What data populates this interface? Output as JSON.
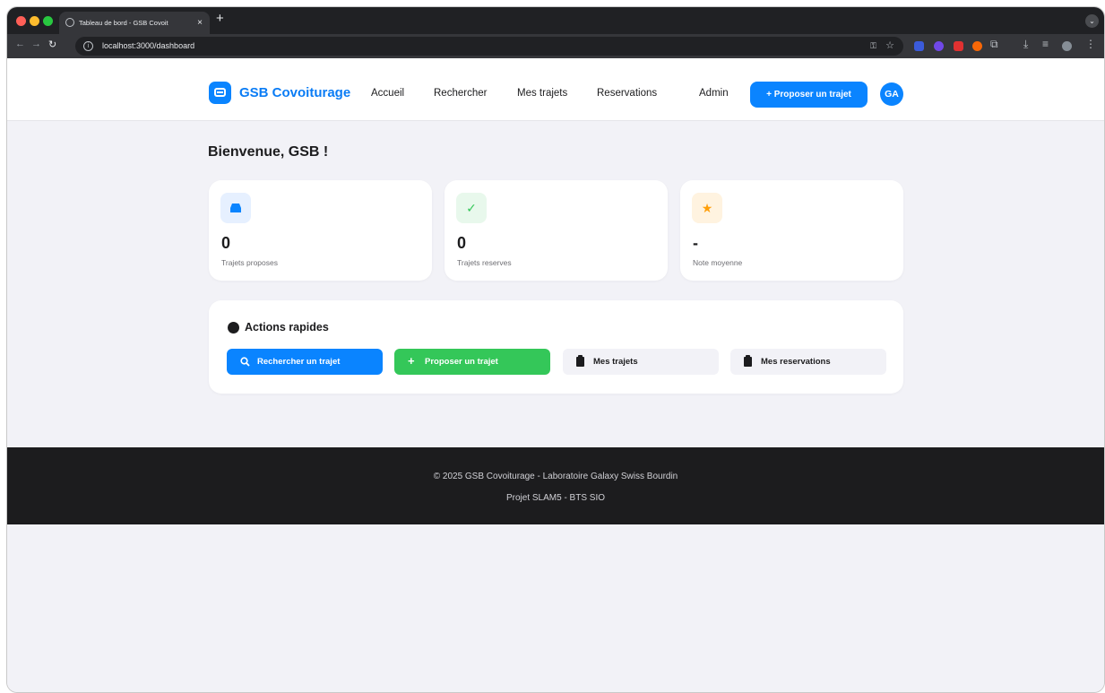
{
  "browser": {
    "tab_title": "Tableau de bord - GSB Covoit",
    "tab_close": "×",
    "new_tab": "+",
    "url": "localhost:3000/dashboard"
  },
  "header": {
    "brand": "GSB Covoiturage",
    "nav": [
      "Accueil",
      "Rechercher",
      "Mes trajets",
      "Reservations",
      "Admin"
    ],
    "cta": "+  Proposer un trajet",
    "avatar": "GA"
  },
  "welcome": "Bienvenue, GSB !",
  "stats": [
    {
      "value": "0",
      "label": "Trajets proposes",
      "icon": "car-icon",
      "icon_bg": "#e6f0ff",
      "icon_color": "#0a84ff"
    },
    {
      "value": "0",
      "label": "Trajets reserves",
      "icon": "check-icon",
      "icon_bg": "#e8f8ec",
      "icon_color": "#34c759"
    },
    {
      "value": "-",
      "label": "Note moyenne",
      "icon": "star-icon",
      "icon_bg": "#fff3e0",
      "icon_color": "#ff9f0a"
    }
  ],
  "quick_actions": {
    "title": "Actions rapides",
    "buttons": [
      {
        "label": "Rechercher un trajet",
        "icon": "search-icon",
        "color": "#0a84ff"
      },
      {
        "label": "Proposer un trajet",
        "icon": "plus-icon",
        "color": "#34c759"
      },
      {
        "label": "Mes trajets",
        "icon": "clipboard-icon",
        "color": "#f2f2f7"
      },
      {
        "label": "Mes reservations",
        "icon": "clipboard-icon",
        "color": "#f2f2f7"
      }
    ]
  },
  "footer": {
    "line1": "© 2025 GSB Covoiturage - Laboratoire Galaxy Swiss Bourdin",
    "line2": "Projet SLAM5 - BTS SIO"
  }
}
